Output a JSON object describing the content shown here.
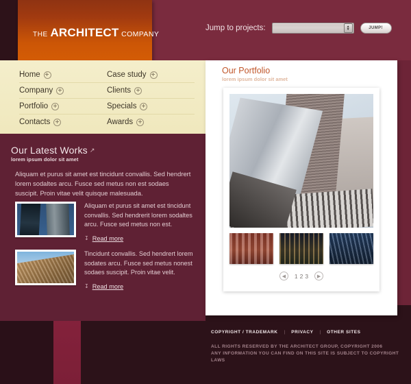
{
  "header": {
    "logo": {
      "the": "THE",
      "name": "ARCHITECT",
      "company": "COMPANY"
    },
    "jump": {
      "label": "Jump to projects:",
      "select_value": "",
      "select_placeholder": "",
      "button_label": "JUMP!"
    }
  },
  "nav": {
    "items": [
      {
        "label": "Home",
        "icon": "plus-circle-icon"
      },
      {
        "label": "Case study",
        "icon": "plus-circle-icon"
      },
      {
        "label": "Company",
        "icon": "plus-circle-icon"
      },
      {
        "label": "Clients",
        "icon": "plus-circle-icon"
      },
      {
        "label": "Portfolio",
        "icon": "plus-circle-icon"
      },
      {
        "label": "Specials",
        "icon": "plus-circle-icon"
      },
      {
        "label": "Contacts",
        "icon": "plus-circle-icon"
      },
      {
        "label": "Awards",
        "icon": "plus-circle-icon"
      }
    ]
  },
  "latest_works": {
    "title": "Our Latest Works",
    "title_icon": "arrow-up-right-icon",
    "subtitle": "lorem ipsum dolor sit amet",
    "intro": "Aliquam et purus sit amet est tincidunt convallis. Sed hendrert lorem sodaltes arcu. Fusce sed metus non est sodaes suscipit. Proin vitae velit quisque malesuada.",
    "items": [
      {
        "thumb": "twin-towers-photo",
        "text": "Aliquam et purus sit amet est tincidunt convallis. Sed hendrerit lorem sodaltes arcu. Fusce sed metus non est.",
        "read_more": "Read more",
        "read_more_icon": "chevron-down-icon"
      },
      {
        "thumb": "glass-facade-photo",
        "text": "Tincidunt convallis. Sed hendrert lorem sodates arcu. Fusce sed metus nonest sodaes suscipit. Proin vitae  velit.",
        "read_more": "Read more",
        "read_more_icon": "chevron-down-icon"
      }
    ]
  },
  "portfolio": {
    "title": "Our Portfolio",
    "subtitle": "lorem ipsum dolor sit amet",
    "hero": "skyscraper-low-angle-photo",
    "thumbnails": [
      {
        "name": "red-brick-building-photo"
      },
      {
        "name": "gothic-building-night-photo"
      },
      {
        "name": "blue-glass-towers-photo"
      }
    ],
    "pager": {
      "prev_icon": "chevron-left-icon",
      "next_icon": "chevron-right-icon",
      "pages": [
        "1",
        "2",
        "3"
      ]
    }
  },
  "footer": {
    "links": [
      "COPYRIGHT / TRADEMARK",
      "PRIVACY",
      "OTHER SITES"
    ],
    "separator": "|",
    "legal_line1": "ALL RIGHTS RESERVED BY THE ARCHITECT GROUP, COPYRIGHT 2006",
    "legal_line2": "ANY INFORMATION YOU CAN FIND ON THIS SITE IS SUBJECT TO COPYRIGHT LAWS"
  },
  "colors": {
    "brand_orange": "#cc5606",
    "maroon": "#6d2437",
    "cream": "#f4eecb",
    "portfolio_accent": "#c0562a",
    "footer_dark": "#2c1219"
  }
}
